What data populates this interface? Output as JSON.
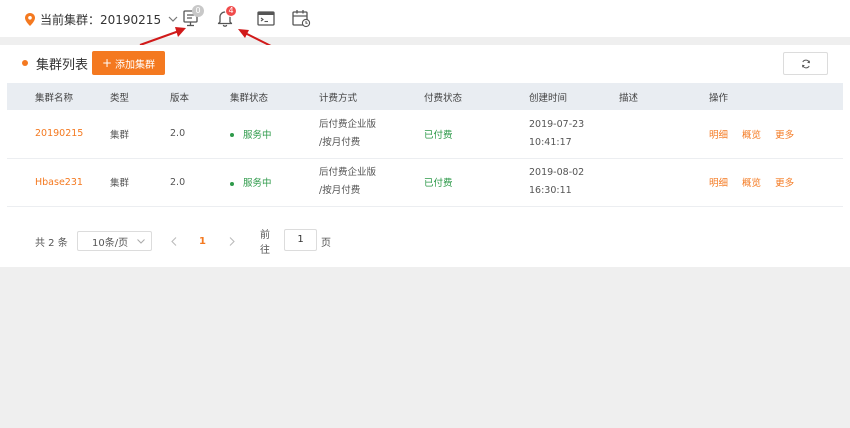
{
  "topbar": {
    "cluster_label": "当前集群：20190215",
    "console_badge": "0",
    "bell_badge": "4"
  },
  "icons": [
    "location-pin-icon",
    "chevron-down-icon",
    "console-monitor-icon",
    "bell-icon",
    "terminal-icon",
    "calendar-clock-icon",
    "refresh-icon",
    "chevron-left-icon",
    "chevron-right-icon"
  ],
  "panel": {
    "title": "集群列表",
    "add_button": "添加集群"
  },
  "table": {
    "columns": [
      "集群名称",
      "类型",
      "版本",
      "集群状态",
      "计费方式",
      "付费状态",
      "创建时间",
      "描述",
      "操作"
    ],
    "rows": [
      {
        "name": "20190215",
        "type": "集群",
        "version": "2.0",
        "status": "服务中",
        "billing_line1": "后付费企业版",
        "billing_line2": "/按月付费",
        "pay_status": "已付费",
        "created_date": "2019-07-23",
        "created_time": "10:41:17",
        "desc": "",
        "ops": [
          "明细",
          "概览",
          "更多"
        ]
      },
      {
        "name": "Hbase231",
        "type": "集群",
        "version": "2.0",
        "status": "服务中",
        "billing_line1": "后付费企业版",
        "billing_line2": "/按月付费",
        "pay_status": "已付费",
        "created_date": "2019-08-02",
        "created_time": "16:30:11",
        "desc": "",
        "ops": [
          "明细",
          "概览",
          "更多"
        ]
      }
    ]
  },
  "pagination": {
    "total": "共 2 条",
    "page_size": "10条/页",
    "current_page": "1",
    "goto_label": "前往",
    "goto_value": "1",
    "page_unit": "页"
  },
  "colors": {
    "accent": "#f47920",
    "success": "#2e9a4a",
    "badge_red": "#f04b4b",
    "arrow_red": "#d11a1a"
  }
}
